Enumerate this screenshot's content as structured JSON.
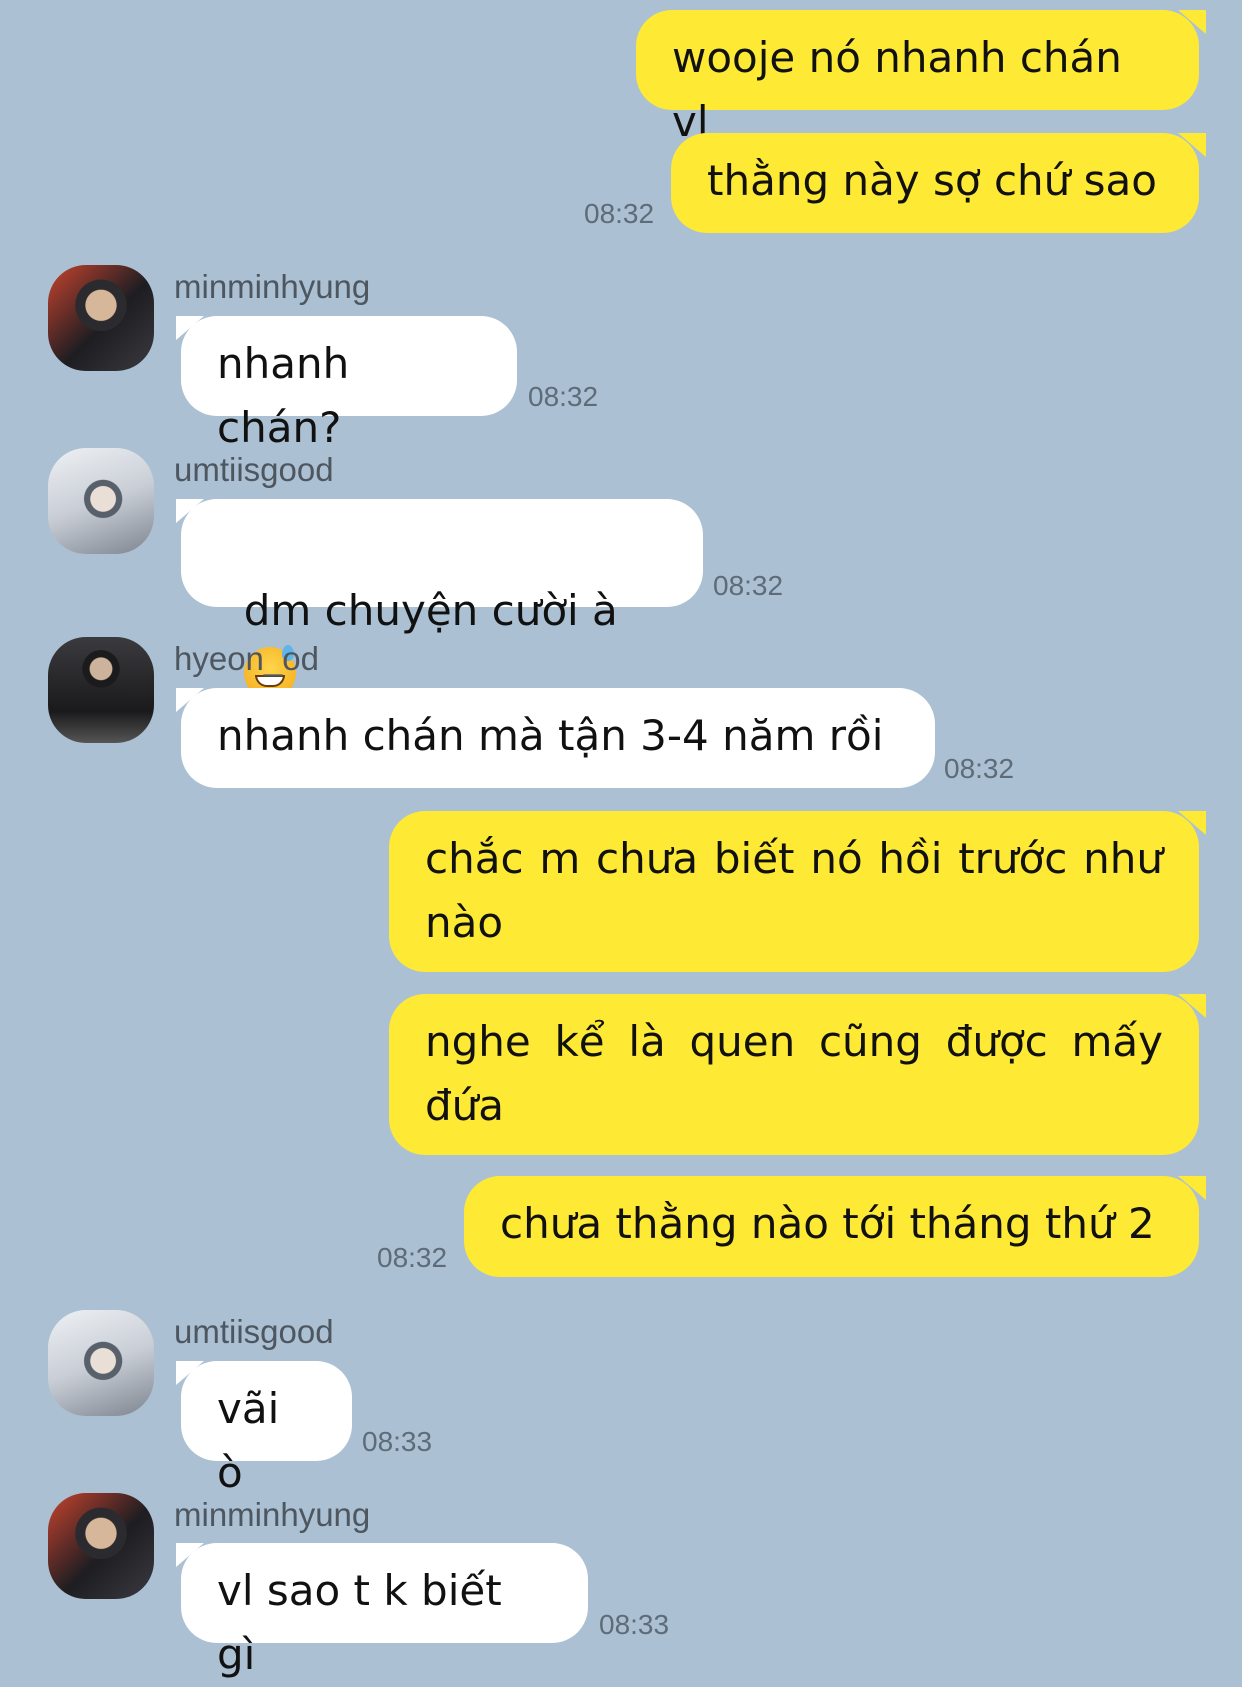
{
  "messages": [
    {
      "id": "m1",
      "from": "me",
      "text": "wooje nó nhanh chán vl"
    },
    {
      "id": "m2",
      "from": "me",
      "text": "thằng này sợ chứ sao",
      "time": "08:32"
    },
    {
      "id": "m3",
      "from": "them",
      "sender": "minminhyung",
      "avatar": "minminhyung-avatar",
      "text": "nhanh chán?",
      "time": "08:32"
    },
    {
      "id": "m4",
      "from": "them",
      "sender": "umtiisgood",
      "avatar": "umtiisgood-avatar",
      "text": "dm chuyện cười à",
      "emoji": "grinning-sweat-emoji",
      "time": "08:32"
    },
    {
      "id": "m5",
      "from": "them",
      "sender": "hyeon_od",
      "avatar": "hyeon_od-avatar",
      "text": "nhanh chán mà tận 3-4 năm rồi",
      "time": "08:32"
    },
    {
      "id": "m6",
      "from": "me",
      "text": "chắc m chưa biết nó hồi trước như nào"
    },
    {
      "id": "m7",
      "from": "me",
      "text": "nghe kể là quen cũng được mấy đứa"
    },
    {
      "id": "m8",
      "from": "me",
      "text": "chưa thằng nào tới tháng thứ 2",
      "time": "08:32"
    },
    {
      "id": "m9",
      "from": "them",
      "sender": "umtiisgood",
      "avatar": "umtiisgood-avatar",
      "text": "vãi ò",
      "time": "08:33"
    },
    {
      "id": "m10",
      "from": "them",
      "sender": "minminhyung",
      "avatar": "minminhyung-avatar",
      "text": "vl sao t k biết gì",
      "time": "08:33"
    }
  ],
  "colors": {
    "background": "#abc1d3",
    "my_bubble": "#fee934",
    "their_bubble": "#ffffff",
    "timestamp": "#5e6b78"
  }
}
